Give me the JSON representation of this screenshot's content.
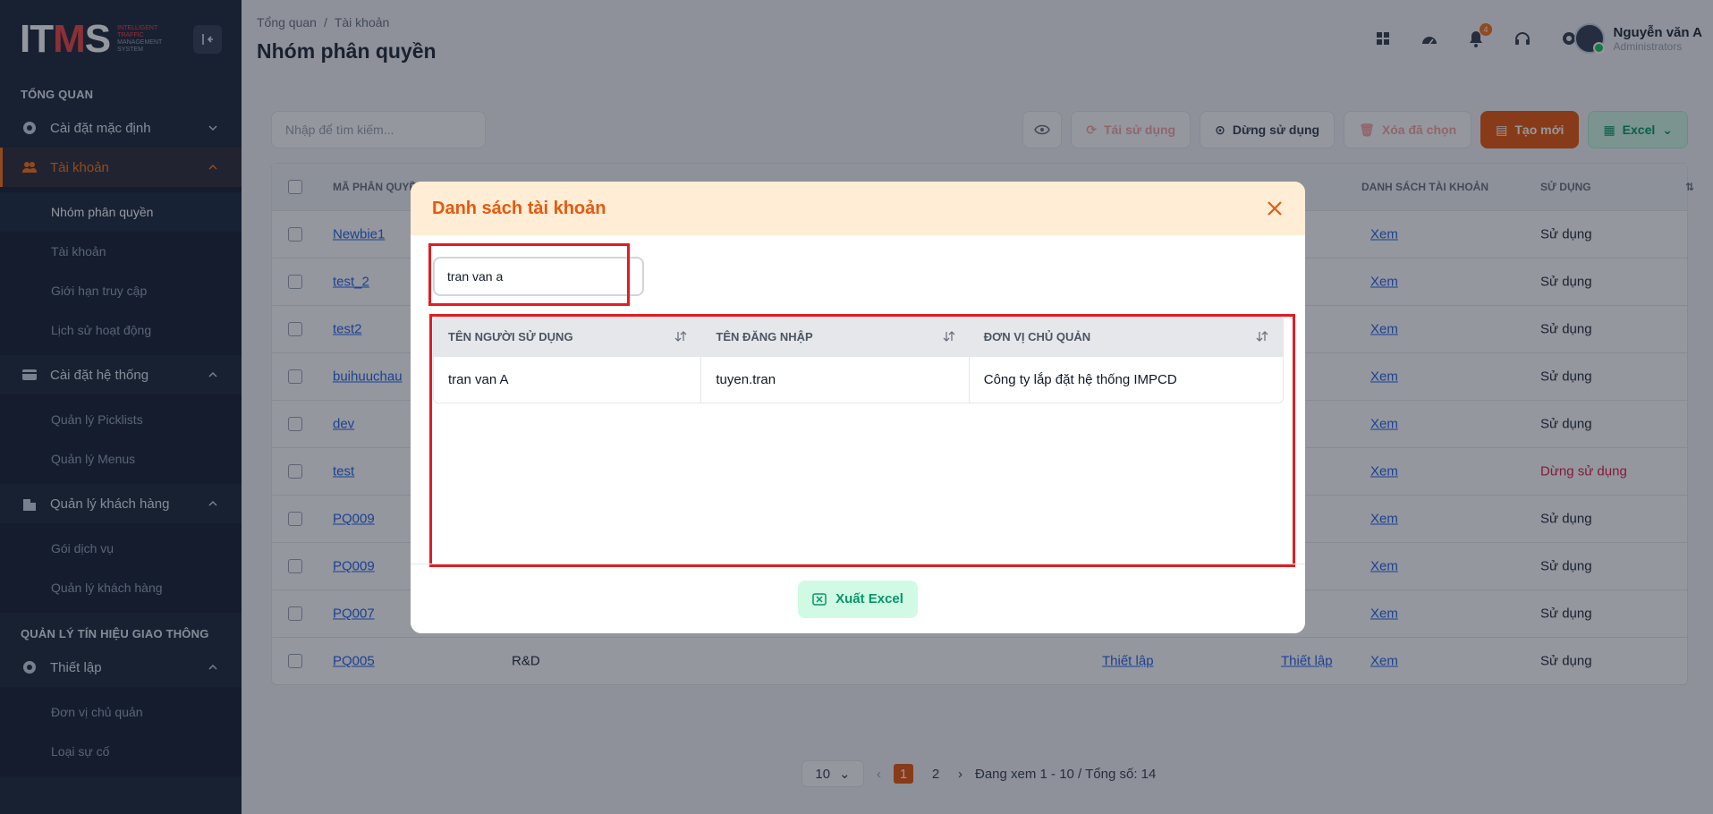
{
  "sidebar": {
    "logo": {
      "mark": "ITMS",
      "line1": "INTELLIGENT",
      "line2": "TRAFFIC",
      "line3": "MANAGEMENT",
      "line4": "SYSTEM"
    },
    "section_overview": "TỔNG QUAN",
    "groups": [
      {
        "label": "Cài đặt mặc định",
        "icon": "gear-icon"
      },
      {
        "label": "Tài khoản",
        "icon": "users-icon"
      },
      {
        "label": "Cài đặt hệ thống",
        "icon": "card-icon"
      },
      {
        "label": "Quản lý khách hàng",
        "icon": "building-icon"
      }
    ],
    "account_items": [
      "Nhóm phân quyền",
      "Tài khoản",
      "Giới hạn truy cập",
      "Lịch sử hoạt động"
    ],
    "system_items": [
      "Quản lý Picklists",
      "Quản lý Menus"
    ],
    "customer_items": [
      "Gói dịch vụ",
      "Quản lý khách hàng"
    ],
    "section_signal": "QUẢN LÝ TÍN HIỆU GIAO THÔNG",
    "setup_group": {
      "label": "Thiết lập",
      "icon": "gear-icon"
    },
    "setup_items": [
      "Đơn vị chủ quản",
      "Loại sự cố"
    ]
  },
  "header": {
    "breadcrumb": [
      "Tổng quan",
      "Tài khoản"
    ],
    "breadcrumb_sep": "/",
    "title": "Nhóm phân quyền",
    "notification_count": "4",
    "user": {
      "name": "Nguyễn văn A",
      "role": "Administrators"
    }
  },
  "toolbar": {
    "search_placeholder": "Nhập để tìm kiếm...",
    "reuse": "Tái sử dụng",
    "stop": "Dừng sử dụng",
    "delete": "Xóa đã chọn",
    "create": "Tạo mới",
    "excel": "Excel"
  },
  "bg_table": {
    "headers": [
      "MÃ PHÂN QUYỀN",
      "DANH SÁCH TÀI KHOẢN",
      "SỬ DỤNG"
    ],
    "view_label": "Xem",
    "setup_label": "Thiết lập",
    "rows": [
      {
        "code": "Newbie1",
        "status": "Sử dụng"
      },
      {
        "code": "test_2",
        "status": "Sử dụng"
      },
      {
        "code": "test2",
        "status": "Sử dụng"
      },
      {
        "code": "buihuuchau",
        "status": "Sử dụng"
      },
      {
        "code": "dev",
        "status": "Sử dụng"
      },
      {
        "code": "test",
        "status": "Dừng sử dụng"
      },
      {
        "code": "PQ009",
        "status": "Sử dụng"
      },
      {
        "code": "PQ009",
        "status": "Sử dụng"
      },
      {
        "code": "PQ007",
        "status": "Sử dụng"
      },
      {
        "code": "PQ005",
        "name": "R&D",
        "status": "Sử dụng"
      }
    ]
  },
  "pagination": {
    "page_size": "10",
    "pages": [
      "1",
      "2"
    ],
    "current": "1",
    "summary": "Đang xem 1 - 10 / Tổng số: 14"
  },
  "modal": {
    "title": "Danh sách tài khoản",
    "search_value": "tran van a",
    "columns": [
      "TÊN NGƯỜI SỬ DỤNG",
      "TÊN ĐĂNG NHẬP",
      "ĐƠN VỊ CHỦ QUẢN"
    ],
    "rows": [
      {
        "full_name": "tran van A",
        "username": "tuyen.tran",
        "unit": "Công ty lắp đặt hệ thống IMPCD"
      }
    ],
    "export_label": "Xuất Excel"
  },
  "colors": {
    "accent": "#ea580c",
    "sidebar": "#1e293b",
    "highlight": "#e11d22",
    "excel": "#059669"
  }
}
